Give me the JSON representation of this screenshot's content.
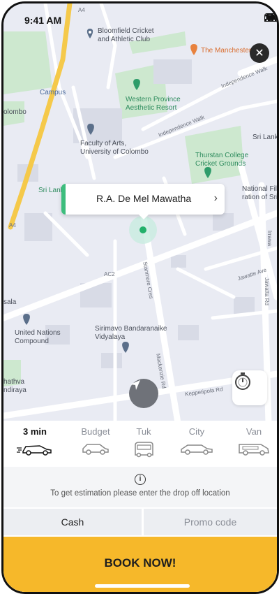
{
  "status_bar": {
    "time": "9:41 AM"
  },
  "map": {
    "places": {
      "bloomfield": "Bloomfield Cricket\nand Athletic Club",
      "manchester": "The Manchester",
      "campus": "Campus",
      "colombo": "olombo",
      "western_province": "Western Province\nAesthetic Resort",
      "faculty_arts": "Faculty of Arts,\nUniversity of Colombo",
      "thurstan": "Thurstan College\nCricket Grounds",
      "sri_lanka_left": "Sri Lank",
      "sri_lanka_right": "Sri Lank",
      "national_film": "National Fil\nration of Sri",
      "un_compound": "United Nations\nCompound",
      "sirimavo": "Sirimavo Bandaranaike\nVidyalaya",
      "sala": "sala",
      "bhathva": "hathva\nndiraya"
    },
    "roads": {
      "a4_top": "A4",
      "a4_left": "A4",
      "ac2": "AC2",
      "independence_walk_1": "Independence Walk",
      "independence_walk_2": "Independence Walk",
      "stanmore": "Stanmore Cres",
      "jawatte": "Jawatte Ave",
      "mackenzie": "Mackenzie Rd",
      "keppetipola": "Keppetipola Rd",
      "jawatta_rd": "Jawatta Rd",
      "irrawaddy": "Irrawa"
    }
  },
  "location_card": {
    "title": "R.A. De Mel Mawatha"
  },
  "vehicles": [
    {
      "label": "3 min",
      "icon": "car-fast-icon",
      "selected": true
    },
    {
      "label": "Budget",
      "icon": "car-budget-icon",
      "selected": false
    },
    {
      "label": "Tuk",
      "icon": "tuk-icon",
      "selected": false
    },
    {
      "label": "City",
      "icon": "car-city-icon",
      "selected": false
    },
    {
      "label": "Van",
      "icon": "van-icon",
      "selected": false
    }
  ],
  "estimation": {
    "message": "To get estimation please enter the drop off location"
  },
  "payment": {
    "cash_label": "Cash",
    "promo_label": "Promo code"
  },
  "book_button": {
    "label": "BOOK NOW!"
  },
  "colors": {
    "accent": "#f6b82a",
    "pin": "#3dbd7d",
    "map_bg": "#e9ebf3",
    "park": "#cde8cf"
  }
}
